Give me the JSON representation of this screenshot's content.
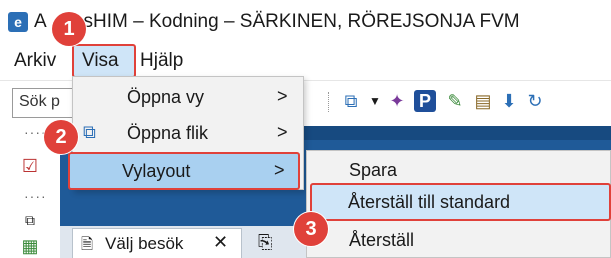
{
  "window": {
    "title": "AssessHIM – Kodning – SÄRKINEN, RÖREJSONJA FVM",
    "title_visible": "ssHIM – Kodning – SÄRKINEN, RÖREJSONJA FVM",
    "title_prefix": "A"
  },
  "menubar": {
    "items": [
      {
        "label": "Arkiv"
      },
      {
        "label": "Visa"
      },
      {
        "label": "Hjälp"
      }
    ]
  },
  "toolbar": {
    "search_value": "Sök p"
  },
  "dropdown": {
    "items": [
      {
        "label": "Öppna vy",
        "arrow": ">"
      },
      {
        "label": "Öppna flik",
        "arrow": ">"
      },
      {
        "label": "Vylayout",
        "arrow": ">"
      }
    ]
  },
  "submenu": {
    "items": [
      {
        "label": "Spara"
      },
      {
        "label": "Återställ till standard"
      },
      {
        "label": "Återställ"
      }
    ]
  },
  "tabs": {
    "items": [
      {
        "label": "Välj besök"
      }
    ]
  },
  "callouts": [
    "1",
    "2",
    "3"
  ],
  "colors": {
    "highlight_border": "#e0413a",
    "selection": "#cfe5f8",
    "band": "#1f5a98"
  }
}
